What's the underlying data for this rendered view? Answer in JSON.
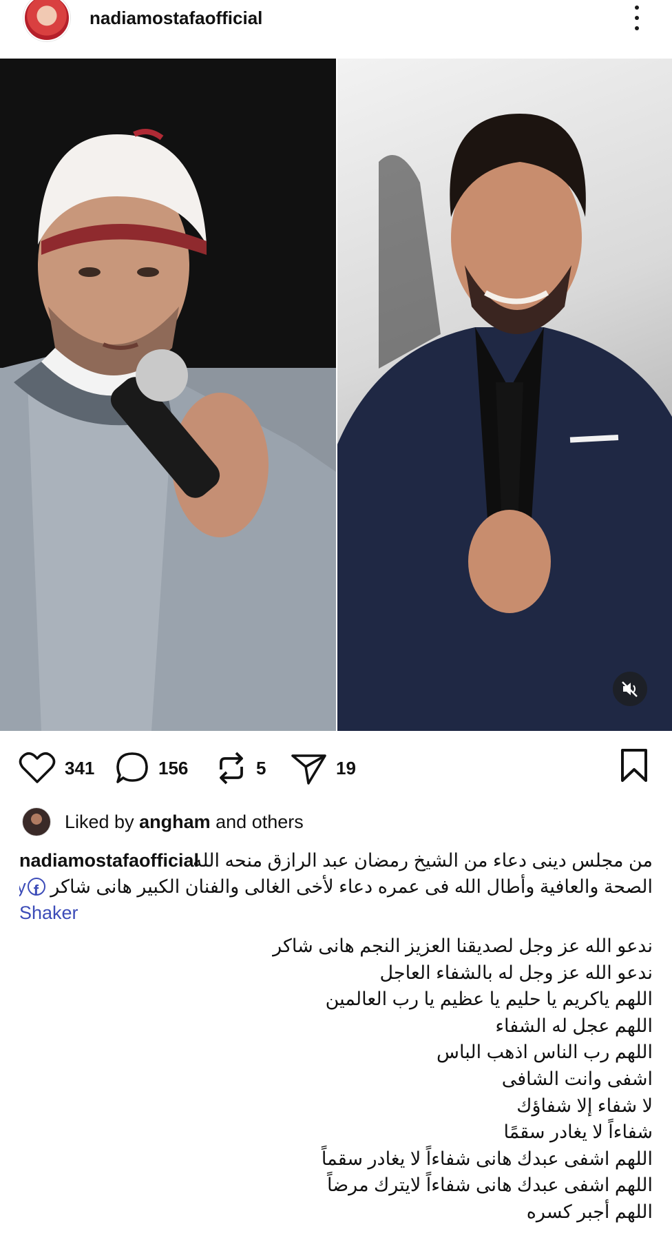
{
  "header": {
    "username": "nadiamostafaofficial"
  },
  "media": {
    "mute_icon": "speaker-muted-icon"
  },
  "actions": {
    "likes": "341",
    "comments": "156",
    "reposts": "5",
    "shares": "19"
  },
  "liked_by": {
    "prefix": "Liked by",
    "name": "angham",
    "suffix": "and others"
  },
  "caption": {
    "username": "nadiamostafaofficial",
    "line1": "من مجلس دينى  دعاء من الشيخ رمضان عبد الرازق منحه الله",
    "line2": "الصحة والعافية وأطال الله فى عمره  دعاء لأخى الغالى والفنان الكبير هانى شاكر",
    "mention_part1": "Hany",
    "mention_part2": "Shaker",
    "lines": [
      "ندعو الله عز وجل لصديقنا العزيز النجم هانى شاكر",
      "ندعو الله عز وجل  له بالشفاء العاجل",
      "اللهم ياكريم يا حليم يا عظيم يا رب العالمين",
      "اللهم عجل له الشفاء",
      "اللهم رب الناس اذهب الباس",
      "اشفى وانت الشافى",
      "لا شفاء إلا شفاؤك",
      "شفاءاً لا يغادر سقمًا",
      "اللهم اشفى عبدك هانى شفاءاً لا يغادر سقماً",
      "اللهم اشفى عبدك هانى شفاءاً لايترك مرضاً",
      "اللهم أجبر كسره"
    ]
  }
}
